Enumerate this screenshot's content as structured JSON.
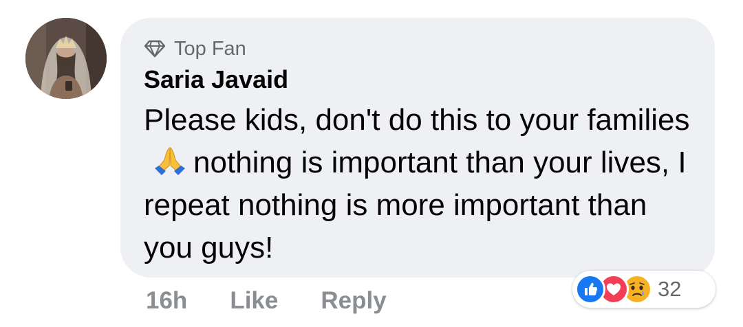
{
  "comment": {
    "badge_label": "Top Fan",
    "author": "Saria Javaid",
    "text_part1": "Please kids, don't do this to your families",
    "emoji": "🙏",
    "text_part2": "nothing is important than your lives, I repeat nothing is more important than you guys!"
  },
  "actions": {
    "time": "16h",
    "like_label": "Like",
    "reply_label": "Reply"
  },
  "reactions": {
    "types": [
      "like",
      "love",
      "sad"
    ],
    "count": "32"
  },
  "colors": {
    "bubble_bg": "#eff0f4",
    "meta_text": "#8a8d91",
    "like_blue": "#1877f2",
    "love_red": "#f33e58",
    "sad_yellow": "#f7b125"
  }
}
